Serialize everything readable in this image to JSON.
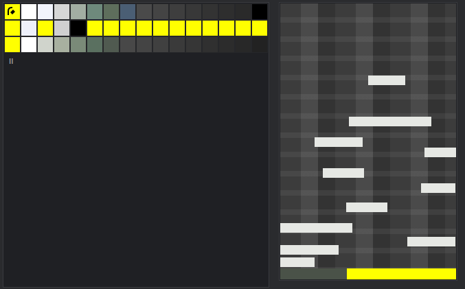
{
  "palette": {
    "rows": [
      [
        {
          "color": "#ffff00"
        },
        {
          "color": "#ffffff"
        },
        {
          "color": "#f2f4fc"
        },
        {
          "color": "#d6d6d6"
        },
        {
          "color": "#a2aea2"
        },
        {
          "color": "#6e8a7c"
        },
        {
          "color": "#5e6e5c"
        },
        {
          "color": "#4a5e74"
        },
        {
          "color": "#4a4a4a"
        },
        {
          "color": "#444444"
        },
        {
          "color": "#3e3e3e"
        },
        {
          "color": "#383838"
        },
        {
          "color": "#333333"
        },
        {
          "color": "#2e2e2e"
        },
        {
          "color": "#2a2a2a"
        },
        {
          "color": "#000000"
        }
      ],
      [
        {
          "color": "#ffff00"
        },
        {
          "color": "#eef0fa"
        },
        {
          "color": "#ffff00"
        },
        {
          "color": "#d0d0d0"
        },
        {
          "color": "#000000"
        },
        {
          "color": "#ffff00"
        },
        {
          "color": "#ffff00"
        },
        {
          "color": "#ffff00"
        },
        {
          "color": "#ffff00"
        },
        {
          "color": "#ffff00"
        },
        {
          "color": "#ffff00"
        },
        {
          "color": "#ffff00"
        },
        {
          "color": "#ffff00"
        },
        {
          "color": "#ffff00"
        },
        {
          "color": "#ffff00"
        },
        {
          "color": "#ffff00"
        }
      ],
      [
        {
          "color": "#ffff00"
        },
        {
          "color": "#ffffff"
        },
        {
          "color": "#d0d4cc"
        },
        {
          "color": "#a8b0a0"
        },
        {
          "color": "#7a8a78"
        },
        {
          "color": "#5a7060"
        },
        {
          "color": "#505a50"
        },
        {
          "color": "#484848"
        },
        {
          "color": "#444444"
        },
        {
          "color": "#404040"
        },
        {
          "color": "#3a3a3a"
        },
        {
          "color": "#363636"
        },
        {
          "color": "#303030"
        },
        {
          "color": "#2c2c2c"
        },
        {
          "color": "#282828"
        },
        {
          "color": "#222222"
        }
      ]
    ]
  },
  "status": "II",
  "canvas": {
    "progress": {
      "level": 0.62
    }
  }
}
